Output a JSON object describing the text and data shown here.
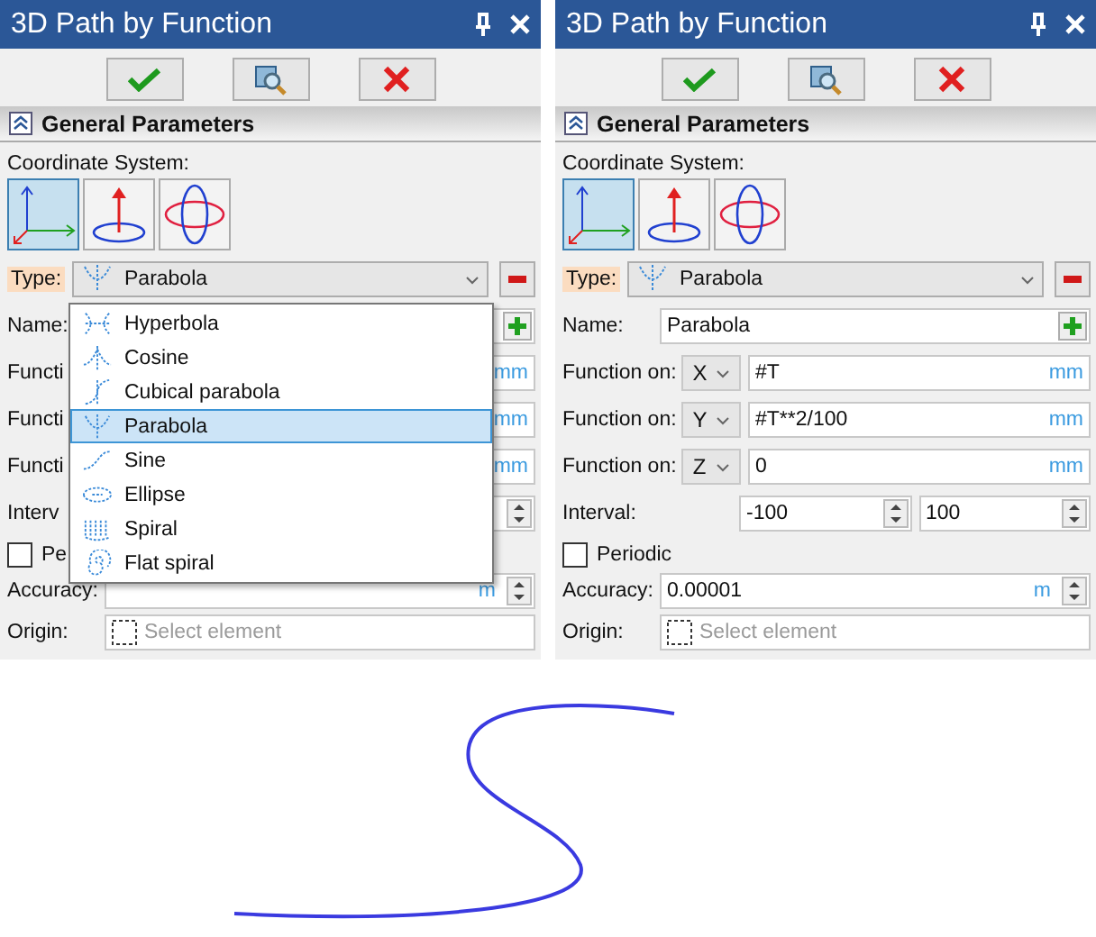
{
  "panels": [
    {
      "title": "3D Path by Function",
      "section": "General Parameters",
      "coord_label": "Coordinate System:",
      "coord_systems": [
        {
          "kind": "cartesian",
          "selected": true
        },
        {
          "kind": "cylindrical",
          "selected": false
        },
        {
          "kind": "spherical",
          "selected": false
        }
      ],
      "type": {
        "label": "Type:",
        "value": "Parabola",
        "kind": "parabola"
      },
      "name": {
        "label": "Name:"
      },
      "functions": [
        {
          "label": "Functi",
          "unit": "mm"
        },
        {
          "label": "Functi",
          "unit": "mm"
        },
        {
          "label": "Functi",
          "unit": "mm"
        }
      ],
      "interval": {
        "label": "Interv"
      },
      "periodic": {
        "label": "Pe",
        "checked": false
      },
      "accuracy": {
        "label": "Accuracy:",
        "unit": "m"
      },
      "origin": {
        "label": "Origin:",
        "placeholder": "Select element"
      },
      "dropdown": [
        {
          "label": "Hyperbola",
          "kind": "hyperbola",
          "selected": false
        },
        {
          "label": "Cosine",
          "kind": "cosine",
          "selected": false
        },
        {
          "label": "Cubical parabola",
          "kind": "cubic",
          "selected": false
        },
        {
          "label": "Parabola",
          "kind": "parabola",
          "selected": true
        },
        {
          "label": "Sine",
          "kind": "sine",
          "selected": false
        },
        {
          "label": "Ellipse",
          "kind": "ellipse",
          "selected": false
        },
        {
          "label": "Spiral",
          "kind": "spiral",
          "selected": false
        },
        {
          "label": "Flat spiral",
          "kind": "flat_spiral",
          "selected": false
        }
      ]
    },
    {
      "title": "3D Path by Function",
      "section": "General Parameters",
      "coord_label": "Coordinate System:",
      "coord_systems": [
        {
          "kind": "cartesian",
          "selected": true
        },
        {
          "kind": "cylindrical",
          "selected": false
        },
        {
          "kind": "spherical",
          "selected": false
        }
      ],
      "type": {
        "label": "Type:",
        "value": "Parabola",
        "kind": "parabola"
      },
      "name": {
        "label": "Name:",
        "value": "Parabola"
      },
      "functions": [
        {
          "label": "Function on:",
          "axis": "X",
          "value": "#T",
          "unit": "mm"
        },
        {
          "label": "Function on:",
          "axis": "Y",
          "value": "#T**2/100",
          "unit": "mm"
        },
        {
          "label": "Function on:",
          "axis": "Z",
          "value": "0",
          "unit": "mm"
        }
      ],
      "interval": {
        "label": "Interval:",
        "from": "-100",
        "to": "100"
      },
      "periodic": {
        "label": "Periodic",
        "checked": false
      },
      "accuracy": {
        "label": "Accuracy:",
        "value": "0.00001",
        "unit": "m"
      },
      "origin": {
        "label": "Origin:",
        "placeholder": "Select element"
      }
    }
  ]
}
